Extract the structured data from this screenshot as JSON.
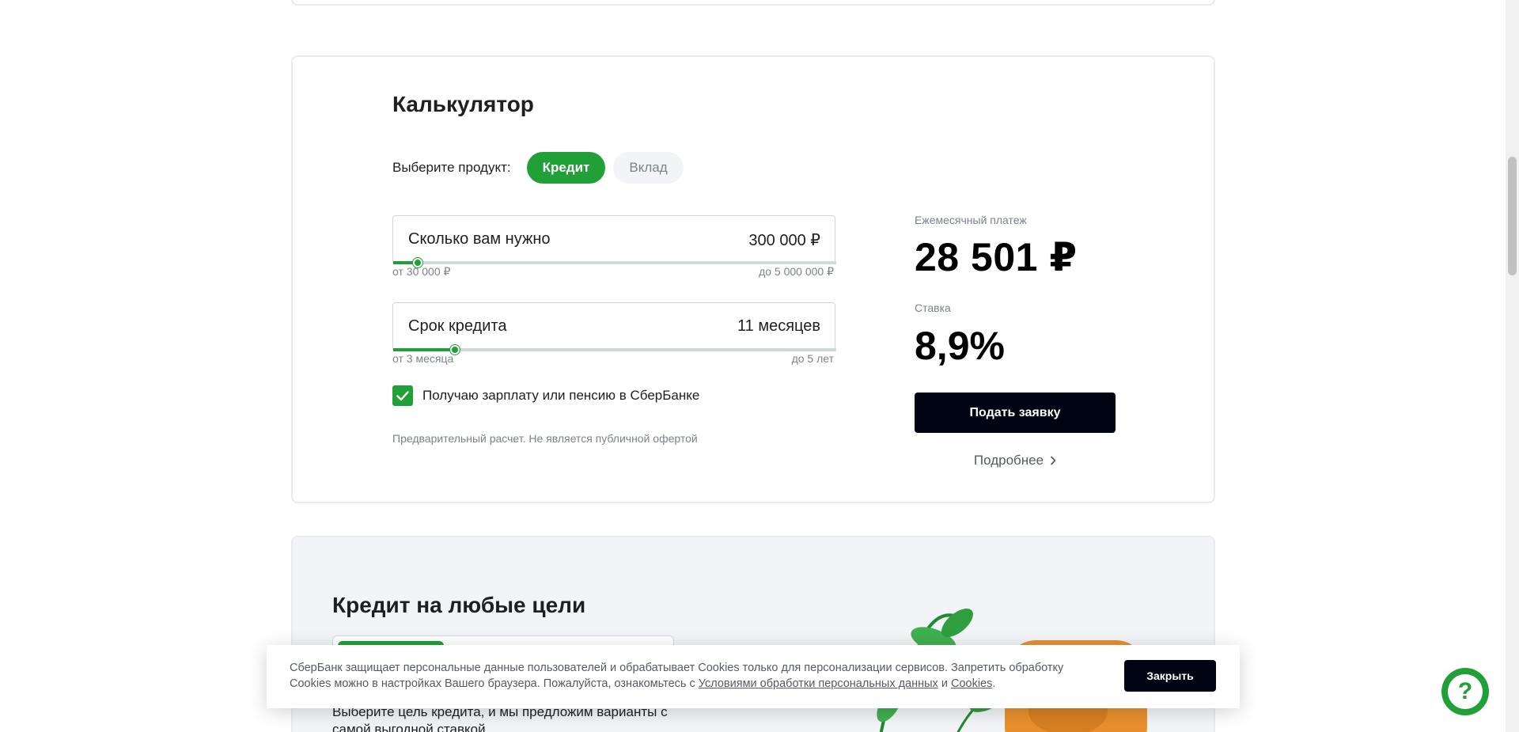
{
  "calculator": {
    "title": "Калькулятор",
    "product_label": "Выберите продукт:",
    "products": [
      {
        "label": "Кредит",
        "active": true
      },
      {
        "label": "Вклад",
        "active": false
      }
    ],
    "amount": {
      "label": "Сколько вам нужно",
      "value": "300 000 ₽",
      "min_label": "от 30 000 ₽",
      "max_label": "до 5 000 000 ₽",
      "slider_fraction": 0.055
    },
    "term": {
      "label": "Срок кредита",
      "value": "11 месяцев",
      "min_label": "от 3 месяца",
      "max_label": "до 5 лет",
      "slider_fraction": 0.14
    },
    "checkbox_label": "Получаю зарплату или пенсию в СберБанке",
    "checkbox_checked": true,
    "disclaimer": "Предварительный расчет. Не является публичной офертой",
    "monthly_label": "Ежемесячный платеж",
    "monthly_value": "28 501 ₽",
    "rate_label": "Ставка",
    "rate_value": "8,9%",
    "apply_button": "Подать заявку",
    "more_link": "Подробнее"
  },
  "credit_section": {
    "title": "Кредит на любые цели",
    "subtitle": "Выберите цель кредита, и мы предложим варианты с самой выгодной ставкой"
  },
  "cookie": {
    "text_before": "СберБанк защищает персональные данные пользователей и обрабатывает Cookies только для персонализации сервисов. Запретить обработку Cookies можно в настройках Вашего браузера. Пожалуйста, ознакомьтесь с ",
    "link1": "Условиями обработки персональных данных",
    "text_mid": " и ",
    "link2": "Cookies",
    "text_after": ".",
    "close_button": "Закрыть"
  },
  "help": {
    "icon": "?"
  },
  "colors": {
    "accent": "#21a038",
    "dark_button": "#000311",
    "muted_text": "#7d838a"
  }
}
